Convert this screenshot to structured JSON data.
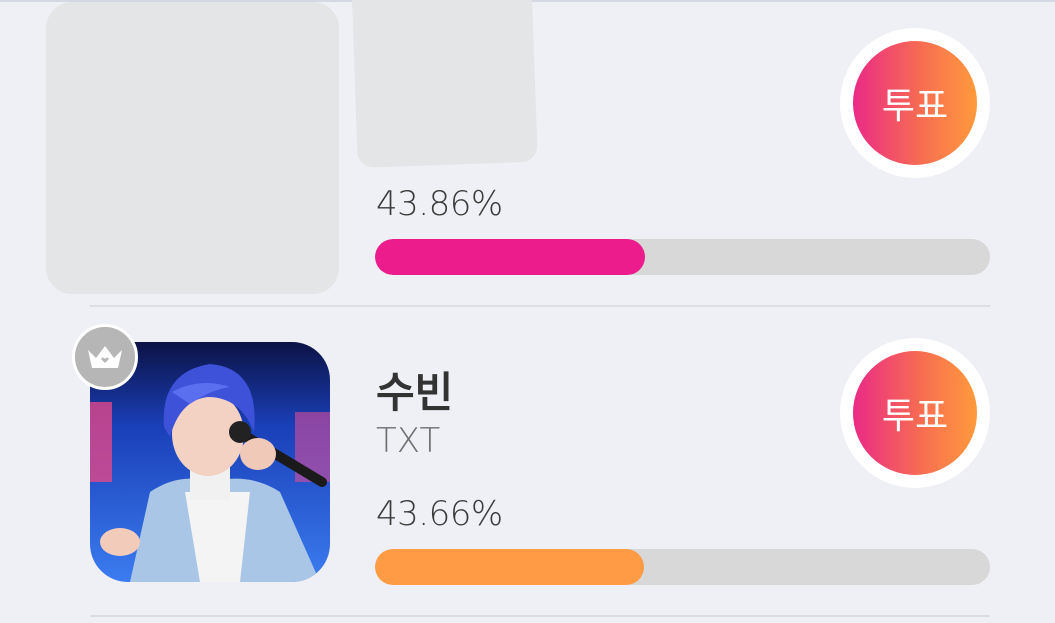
{
  "entries": [
    {
      "name": "",
      "group": "",
      "percent_text": "43.86%",
      "percent_value": 43.86,
      "bar_color": "#ec1c8c",
      "vote_label": "투표",
      "loading": true
    },
    {
      "name": "수빈",
      "group": "TXT",
      "percent_text": "43.66%",
      "percent_value": 43.66,
      "bar_color": "#ff9a45",
      "vote_label": "투표",
      "loading": false,
      "badge_icon": "crown-icon"
    }
  ],
  "colors": {
    "page_bg": "#eef0f5",
    "track": "#d8d8d8",
    "vote_gradient_start": "#ea2a86",
    "vote_gradient_end": "#ff9a3c",
    "badge": "#b6b6b6"
  }
}
